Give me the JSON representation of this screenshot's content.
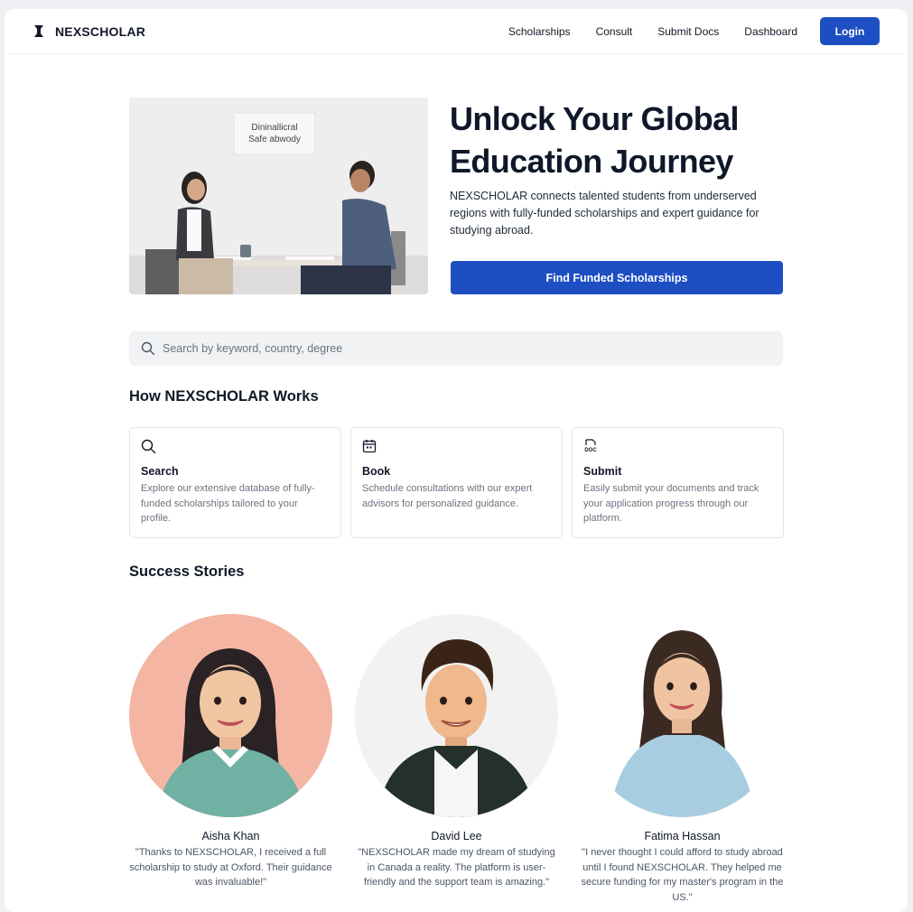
{
  "brand": {
    "name": "NEXSCHOLAR"
  },
  "nav": {
    "links": [
      "Scholarships",
      "Consult",
      "Submit Docs",
      "Dashboard"
    ],
    "login_label": "Login"
  },
  "hero": {
    "image_caption": [
      "Dininallicral",
      "Safe abwody"
    ],
    "title_line1": "Unlock Your Global",
    "title_line2": "Education Journey",
    "description": "NEXSCHOLAR connects talented students from underserved regions with fully-funded scholarships and expert guidance for studying abroad.",
    "cta_label": "Find Funded Scholarships"
  },
  "search": {
    "placeholder": "Search by keyword, country, degree",
    "value": ""
  },
  "how": {
    "heading": "How NEXSCHOLAR Works",
    "cards": [
      {
        "icon": "search-icon",
        "title": "Search",
        "description": "Explore our extensive database of fully-funded scholarships tailored to your profile."
      },
      {
        "icon": "calendar-icon",
        "title": "Book",
        "description": "Schedule consultations with our expert advisors for personalized guidance."
      },
      {
        "icon": "document-icon",
        "icon_text": "DOC",
        "title": "Submit",
        "description": "Easily submit your documents and track your application progress through our platform."
      }
    ]
  },
  "stories": {
    "heading": "Success Stories",
    "items": [
      {
        "name": "Aisha Khan",
        "quote": "\"Thanks to NEXSCHOLAR, I received a full scholarship to study at Oxford. Their guidance was invaluable!\""
      },
      {
        "name": "David Lee",
        "quote": "\"NEXSCHOLAR made my dream of studying in Canada a reality. The platform is user-friendly and the support team is amazing.\""
      },
      {
        "name": "Fatima Hassan",
        "quote": "\"I never thought I could afford to study abroad until I found NEXSCHOLAR. They helped me secure funding for my master's program in the US.\""
      }
    ]
  },
  "colors": {
    "primary": "#1d4ec2",
    "search_bg": "#f1f2f4",
    "avatar1_bg": "#f4b5a2",
    "avatar2_bg": "#f2f2f2"
  }
}
